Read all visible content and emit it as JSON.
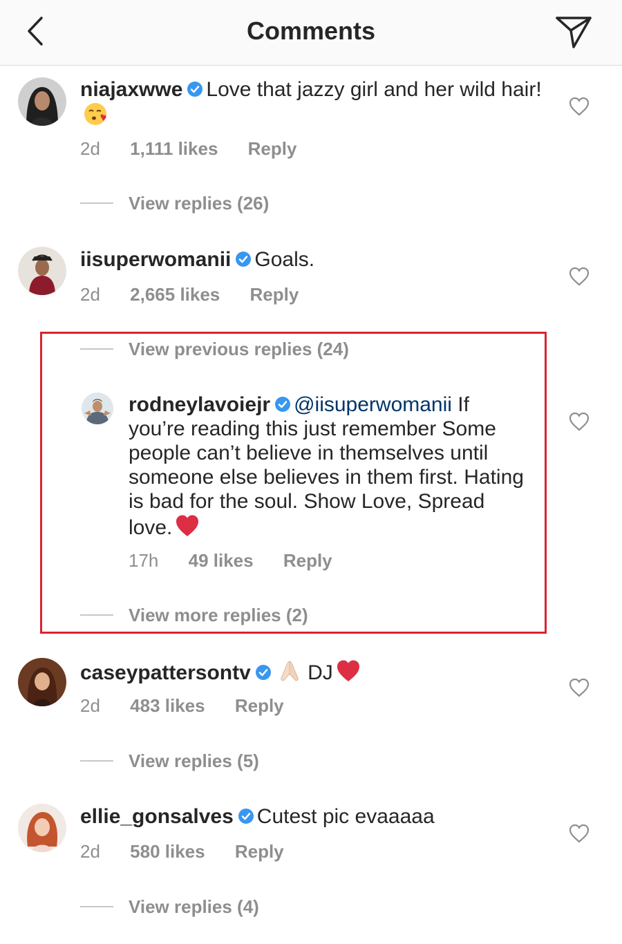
{
  "header": {
    "title": "Comments"
  },
  "comments": [
    {
      "username": "niajaxwwe",
      "text": "Love that jazzy girl and her wild hair!",
      "emoji": "kiss-face-emoji",
      "time": "2d",
      "likes": "1,111 likes",
      "reply_label": "Reply",
      "view_replies": "View replies (26)"
    },
    {
      "username": "iisuperwomanii",
      "text": "Goals.",
      "time": "2d",
      "likes": "2,665 likes",
      "reply_label": "Reply",
      "view_previous": "View previous replies (24)",
      "reply": {
        "username": "rodneylavoiejr",
        "mention": "@iisuperwomanii",
        "text": "If you’re reading this just remember Some people can’t believe in themselves until someone else believes in them first. Hating is bad for the soul. Show Love, Spread love.",
        "emoji": "red-heart-emoji",
        "time": "17h",
        "likes": "49 likes",
        "reply_label": "Reply"
      },
      "view_more": "View more replies (2)"
    },
    {
      "username": "caseypattersontv",
      "text": "DJ",
      "emojis": [
        "folded-hands-emoji",
        "red-heart-emoji"
      ],
      "time": "2d",
      "likes": "483 likes",
      "reply_label": "Reply",
      "view_replies": "View replies (5)"
    },
    {
      "username": "ellie_gonsalves",
      "text": "Cutest pic evaaaaa",
      "time": "2d",
      "likes": "580 likes",
      "reply_label": "Reply",
      "view_replies": "View replies (4)"
    }
  ],
  "colors": {
    "verified_blue": "#3897f0",
    "highlight_red": "#d9242e",
    "muted_gray": "#8e8e8e",
    "mention_blue": "#003569"
  }
}
